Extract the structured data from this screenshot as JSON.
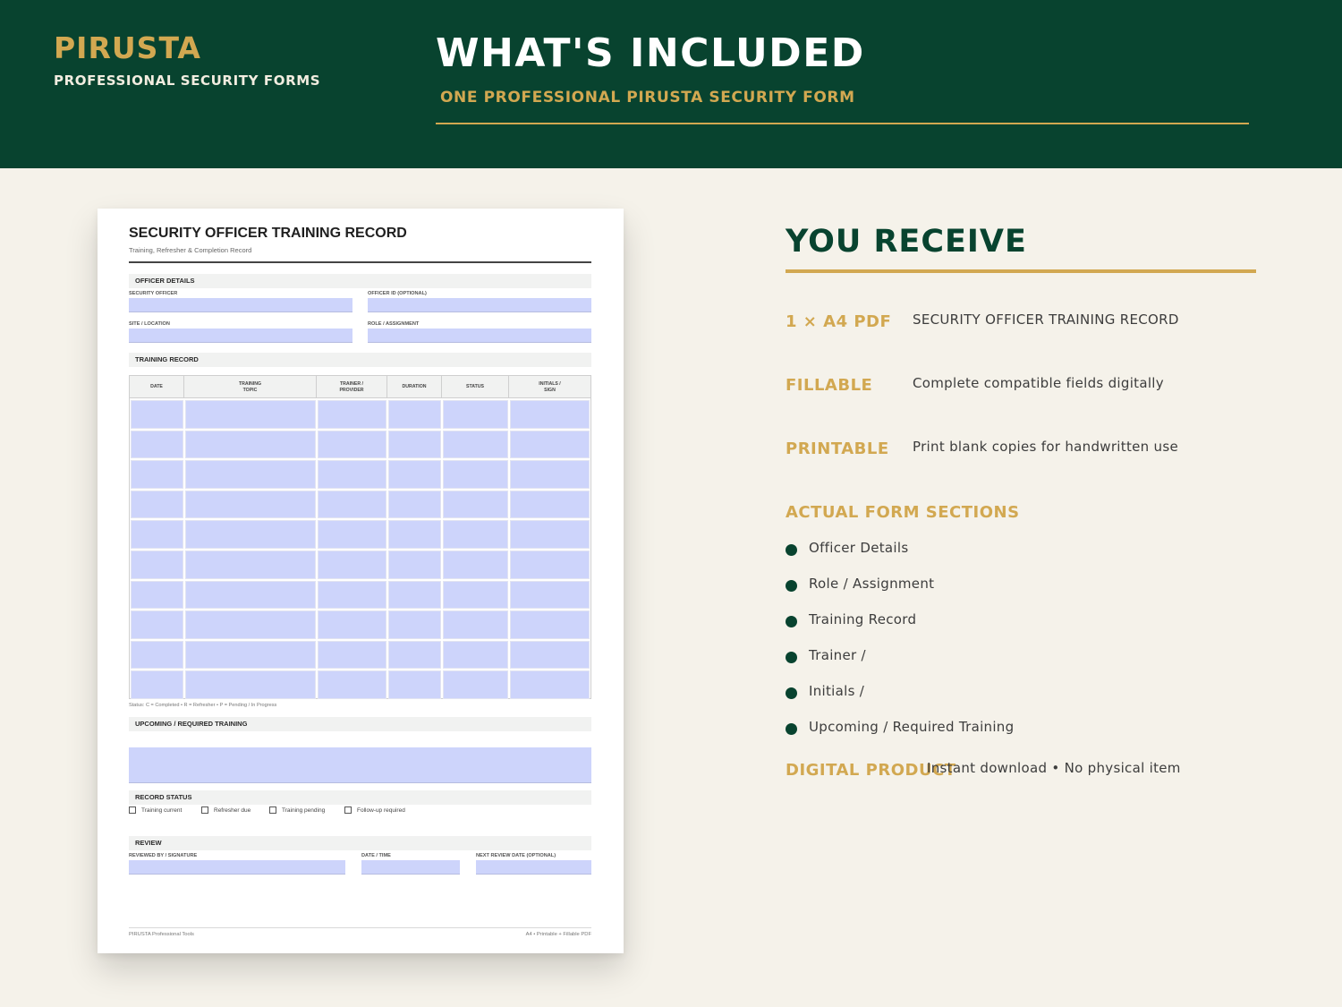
{
  "header": {
    "brand_name": "PIRUSTA",
    "brand_tagline": "PROFESSIONAL SECURITY FORMS",
    "title": "WHAT'S INCLUDED",
    "subtitle": "ONE PROFESSIONAL PIRUSTA SECURITY FORM"
  },
  "colors": {
    "dark_green": "#08432f",
    "gold": "#d2a851",
    "cream": "#f5f2ea",
    "field_fill": "#cdd4fb"
  },
  "form": {
    "title": "SECURITY OFFICER TRAINING RECORD",
    "subtitle": "Training, Refresher & Completion Record",
    "officer_details": {
      "heading": "OFFICER DETAILS",
      "security_officer": "SECURITY OFFICER",
      "officer_id": "OFFICER ID (OPTIONAL)",
      "site_location": "SITE / LOCATION",
      "role_assignment": "ROLE / ASSIGNMENT"
    },
    "training_record": {
      "heading": "TRAINING RECORD",
      "columns": [
        "DATE",
        "TRAINING\nTOPIC",
        "TRAINER /\nPROVIDER",
        "DURATION",
        "STATUS",
        "INITIALS /\nSIGN"
      ],
      "row_count": 10,
      "legend": "Status: C = Completed   •   R = Refresher   •   P = Pending / In Progress"
    },
    "upcoming": {
      "heading": "UPCOMING / REQUIRED TRAINING"
    },
    "record_status": {
      "heading": "RECORD STATUS",
      "options": [
        "Training current",
        "Refresher due",
        "Training pending",
        "Follow-up required"
      ]
    },
    "review": {
      "heading": "REVIEW",
      "reviewed_by": "REVIEWED BY / SIGNATURE",
      "date_time": "DATE / TIME",
      "next_review": "NEXT REVIEW DATE (OPTIONAL)"
    },
    "footer_left": "PIRUSTA Professional Tools",
    "footer_right": "A4 • Printable + Fillable PDF"
  },
  "receive": {
    "title": "YOU RECEIVE",
    "specs": [
      {
        "key": "1 × A4 PDF",
        "value": "SECURITY OFFICER TRAINING RECORD"
      },
      {
        "key": "FILLABLE",
        "value": "Complete compatible fields digitally"
      },
      {
        "key": "PRINTABLE",
        "value": "Print blank copies for handwritten use"
      }
    ],
    "sections_heading": "ACTUAL FORM SECTIONS",
    "sections": [
      "Officer Details",
      "Role / Assignment",
      "Training Record",
      "Trainer /",
      "Initials /",
      "Upcoming / Required Training"
    ],
    "digital_key": "DIGITAL PRODUCT",
    "digital_value": "Instant download • No physical item"
  }
}
